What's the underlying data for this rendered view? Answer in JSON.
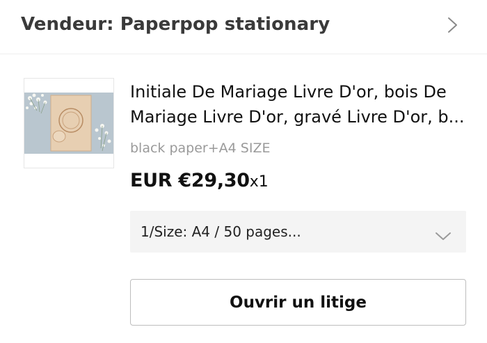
{
  "seller": {
    "title": "Vendeur: Paperpop stationary",
    "chevron_icon": "chevron-right-icon"
  },
  "product": {
    "title": "Initiale De Mariage Livre D'or, bois De Mariage Livre D'or, gravé Livre D'or, b...",
    "variant": "black paper+A4 SIZE",
    "price": "EUR €29,30",
    "quantity": "x1",
    "size_select": {
      "value": "1/Size: A4 / 50 pages...",
      "chevron_icon": "chevron-down-icon"
    }
  },
  "actions": {
    "dispute_label": "Ouvrir un litige"
  },
  "colors": {
    "select_bg": "#f4f4f4",
    "button_border": "#bdbdbd",
    "muted_text": "#9a9a9a"
  }
}
